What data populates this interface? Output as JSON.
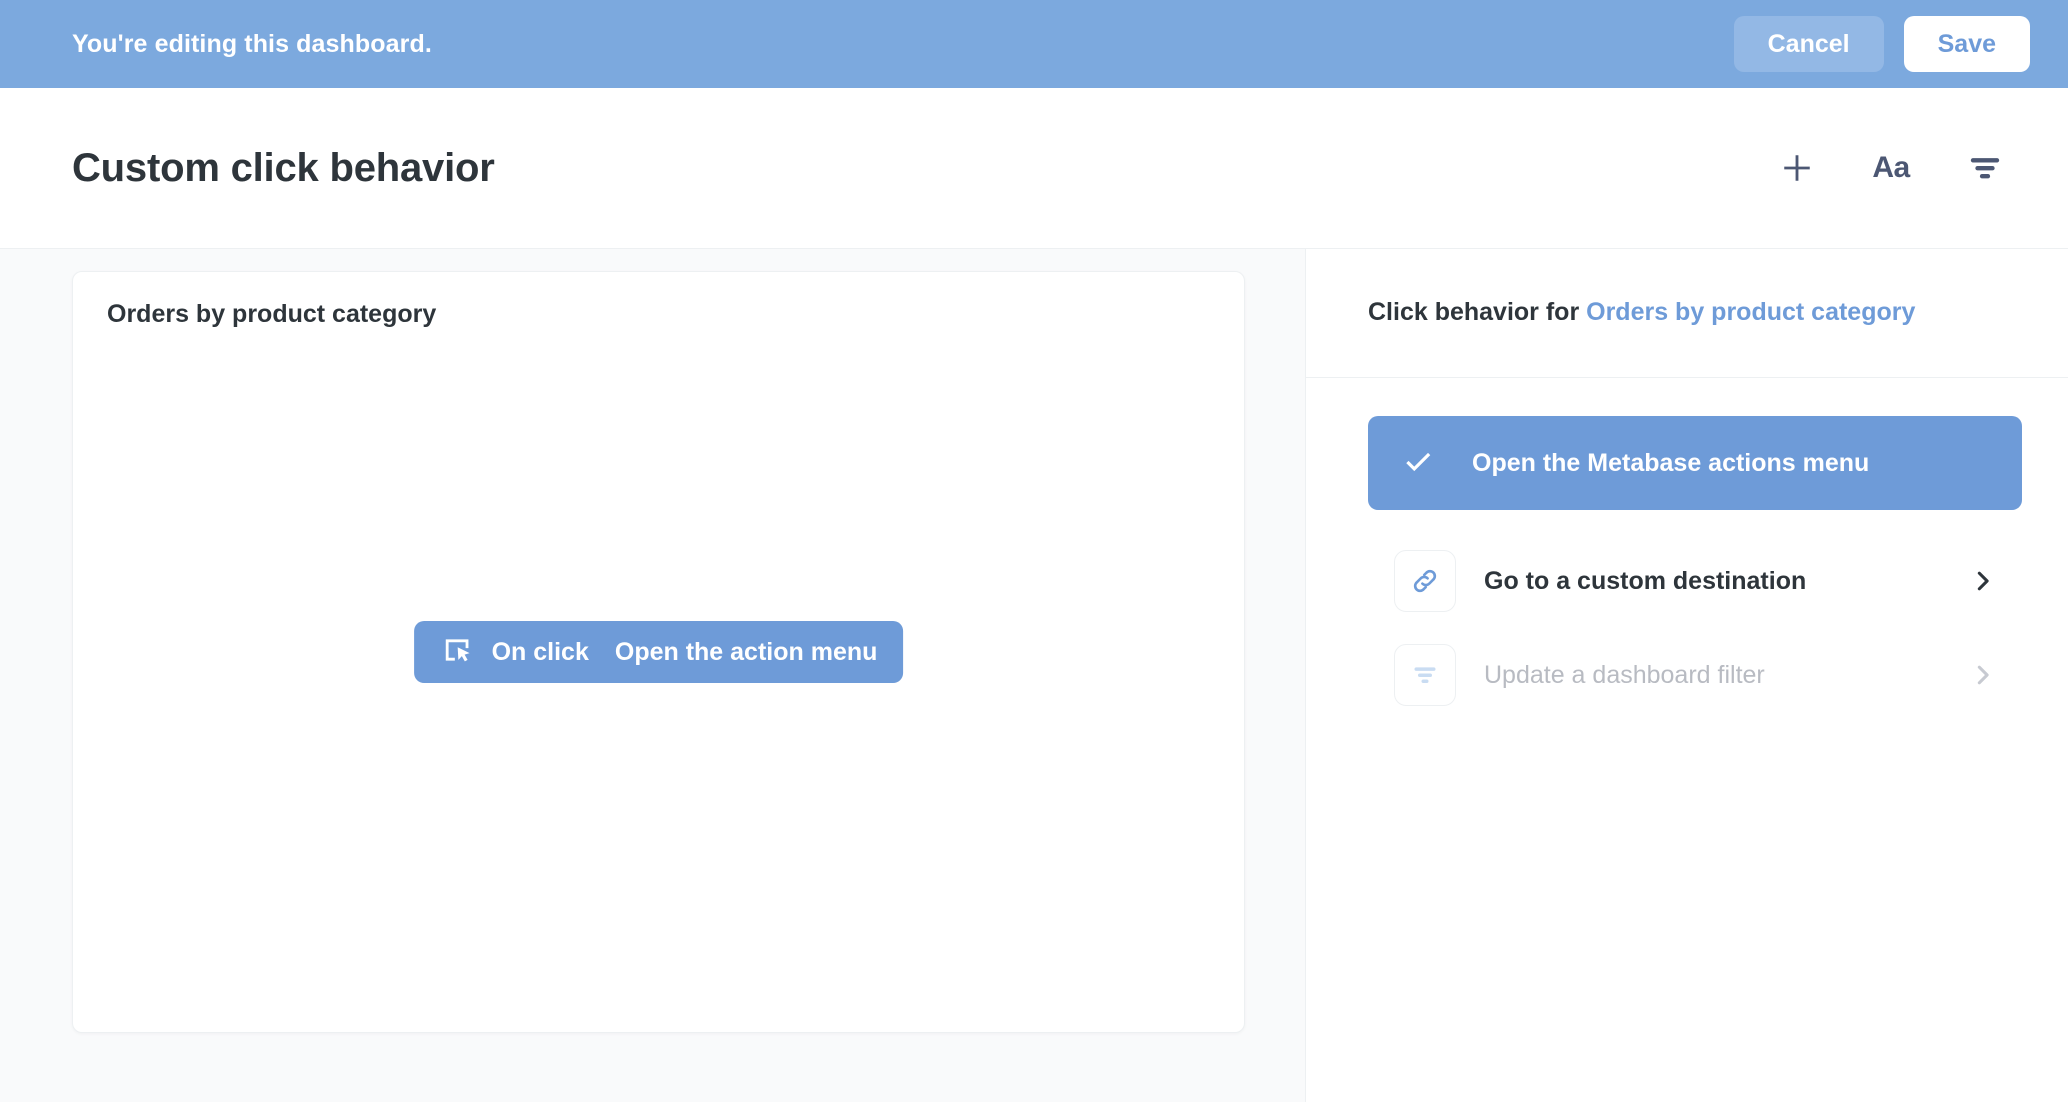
{
  "edit_banner": {
    "message": "You're editing this dashboard.",
    "cancel_label": "Cancel",
    "save_label": "Save",
    "background_color": "#7CA9DE"
  },
  "dashboard_header": {
    "title": "Custom click behavior",
    "icons": [
      {
        "name": "add-icon",
        "label": "+"
      },
      {
        "name": "text-card-icon",
        "label": "Aa"
      },
      {
        "name": "filter-icon",
        "label": ""
      }
    ]
  },
  "canvas": {
    "card": {
      "title": "Orders by product category",
      "onclick_pill": {
        "icon": "click-target-icon",
        "label": "On click",
        "value": "Open the action menu"
      }
    }
  },
  "sidebar": {
    "header": {
      "prefix": "Click behavior for",
      "target": "Orders by product category",
      "target_color": "#6E9BD8"
    },
    "options": [
      {
        "name": "open-actions-menu",
        "label": "Open the Metabase actions menu",
        "icon": "check-icon",
        "selected": true,
        "disabled": false,
        "accent_color": "#6E9BD8"
      },
      {
        "name": "custom-destination",
        "label": "Go to a custom destination",
        "icon": "link-icon",
        "selected": false,
        "disabled": false,
        "chevron": "›"
      },
      {
        "name": "update-dashboard-filter",
        "label": "Update a dashboard filter",
        "icon": "filter-icon",
        "selected": false,
        "disabled": true,
        "chevron": "›"
      }
    ]
  }
}
